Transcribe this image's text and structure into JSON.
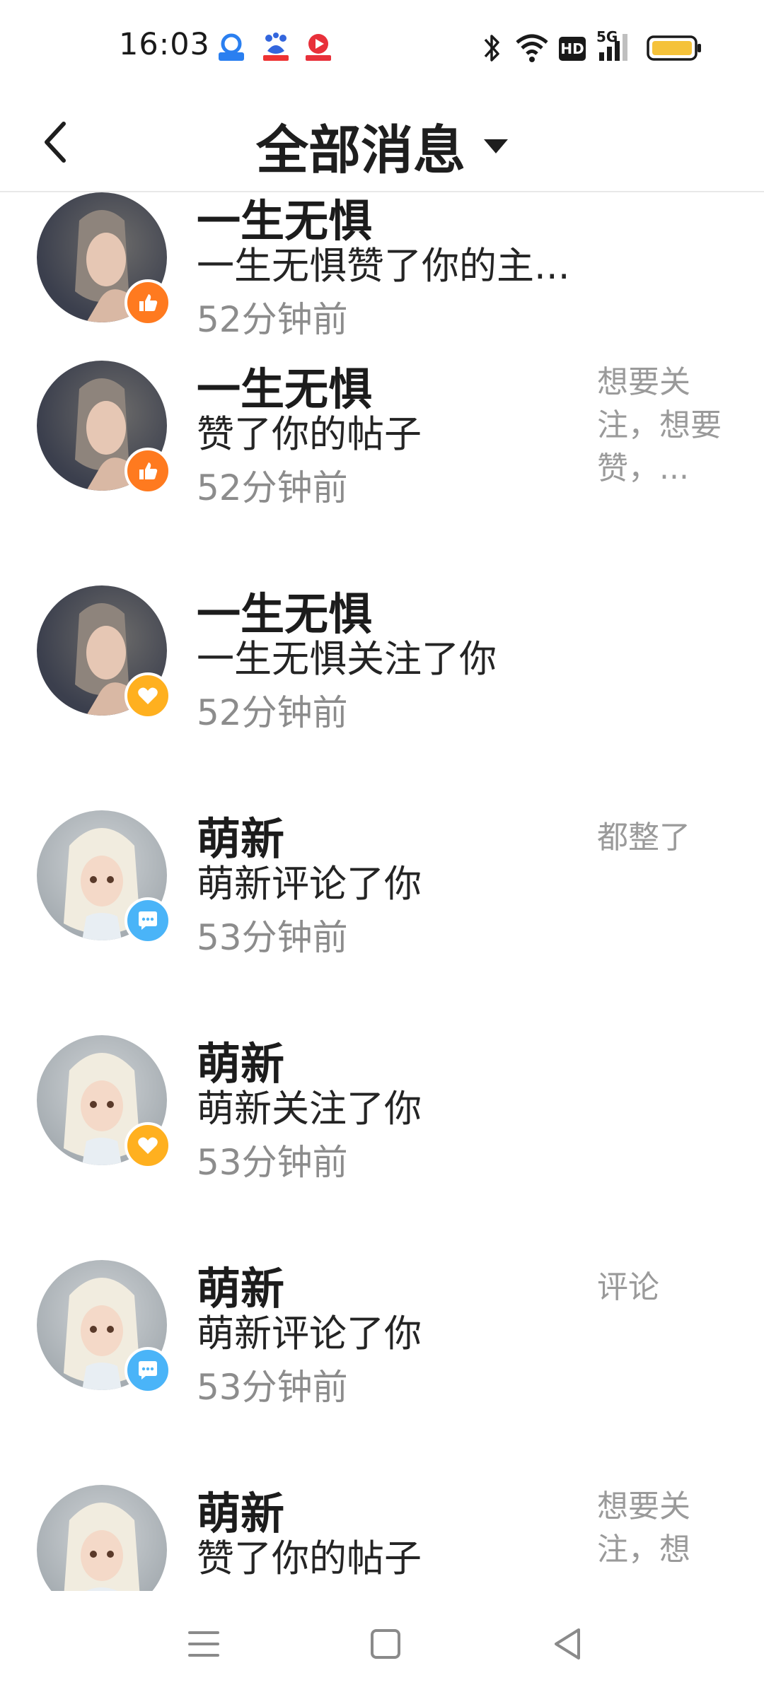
{
  "status_bar": {
    "time": "16:03",
    "app_icons": [
      "qq-browser-icon",
      "baidu-icon",
      "video-app-icon"
    ],
    "indicators": [
      "bluetooth-icon",
      "wifi-icon",
      "hd-icon",
      "signal-5g-icon",
      "battery-icon"
    ],
    "hd_label": "HD",
    "network_label": "5G",
    "battery_color": "#f5c23a"
  },
  "header": {
    "title": "全部消息",
    "back_icon": "back-arrow-icon",
    "dropdown_icon": "caret-down-icon"
  },
  "messages": [
    {
      "name": "一生无惧",
      "text": "一生无惧赞了你的主...",
      "time": "52分钟前",
      "type": "like",
      "excerpt": ""
    },
    {
      "name": "一生无惧",
      "text": "赞了你的帖子",
      "time": "52分钟前",
      "type": "like",
      "excerpt": "想要关注，想要赞，..."
    },
    {
      "name": "一生无惧",
      "text": "一生无惧关注了你",
      "time": "52分钟前",
      "type": "follow",
      "excerpt": ""
    },
    {
      "name": "萌新",
      "text": "萌新评论了你",
      "time": "53分钟前",
      "type": "comment",
      "excerpt": "都整了"
    },
    {
      "name": "萌新",
      "text": "萌新关注了你",
      "time": "53分钟前",
      "type": "follow",
      "excerpt": ""
    },
    {
      "name": "萌新",
      "text": "萌新评论了你",
      "time": "53分钟前",
      "type": "comment",
      "excerpt": "评论"
    },
    {
      "name": "萌新",
      "text": "赞了你的帖子",
      "time": "",
      "type": "like",
      "excerpt": "想要关注，想"
    }
  ],
  "colors": {
    "like_badge": "#ff7a1f",
    "follow_badge": "#ffb01f",
    "comment_badge": "#4ab4f8"
  },
  "nav_bar": [
    "menu-icon",
    "home-square-icon",
    "back-triangle-icon"
  ]
}
